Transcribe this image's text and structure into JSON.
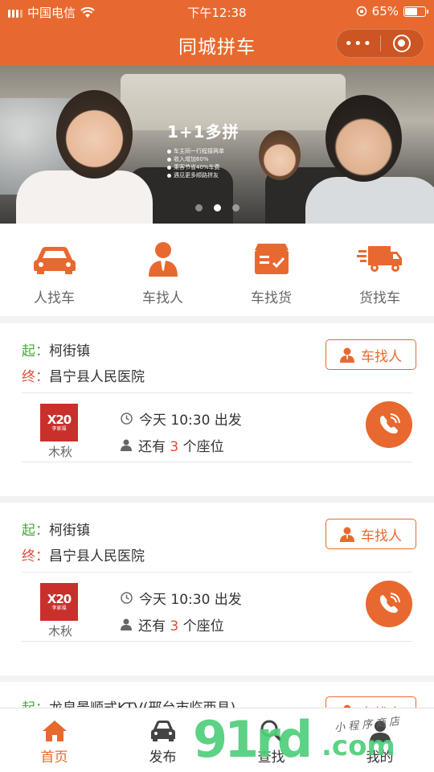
{
  "status_bar": {
    "carrier": "中国电信",
    "time": "下午12:38",
    "battery": "65%",
    "battery_level": 0.65
  },
  "nav": {
    "title": "同城拼车",
    "more_label": "•••"
  },
  "banner": {
    "title": "1+1多拼",
    "lines": [
      "车主同一行程接两单",
      "收入增加60%",
      "乘客节省40%车费",
      "遇见更多顺路拼友"
    ],
    "slide_count": 3,
    "active_slide": 2
  },
  "categories": [
    {
      "label": "人找车",
      "icon": "car-icon"
    },
    {
      "label": "车找人",
      "icon": "person-icon"
    },
    {
      "label": "车找货",
      "icon": "cargo-box-icon"
    },
    {
      "label": "货找车",
      "icon": "truck-icon"
    }
  ],
  "trips": [
    {
      "from_tag": "起：",
      "from": "柯街镇",
      "to_tag": "终：",
      "to": "昌宁县人民医院",
      "role": "车找人",
      "avatar_big": "X20",
      "avatar_small": "李家福",
      "driver": "木秋",
      "depart": "今天 10:30 出发",
      "seats_prefix": "还有",
      "seats_count": "3",
      "seats_suffix": "个座位"
    },
    {
      "from_tag": "起：",
      "from": "柯街镇",
      "to_tag": "终：",
      "to": "昌宁县人民医院",
      "role": "车找人",
      "avatar_big": "X20",
      "avatar_small": "李家福",
      "driver": "木秋",
      "depart": "今天 10:30 出发",
      "seats_prefix": "还有",
      "seats_count": "3",
      "seats_suffix": "个座位"
    },
    {
      "from_tag": "起：",
      "from": "龙泉景顺式KTV(邢台市临西县)",
      "role": "车找人"
    }
  ],
  "tabs": [
    {
      "label": "首页",
      "icon": "home-icon",
      "active": true
    },
    {
      "label": "发布",
      "icon": "car-front-icon",
      "active": false
    },
    {
      "label": "查找",
      "icon": "search-icon",
      "active": false
    },
    {
      "label": "我的",
      "icon": "user-icon",
      "active": false
    }
  ],
  "watermark": {
    "main": "91rd",
    "com": ".com",
    "small": "小程序商店"
  },
  "colors": {
    "brand": "#e8692f",
    "start_green": "#47a83a",
    "end_red": "#e04b36"
  }
}
